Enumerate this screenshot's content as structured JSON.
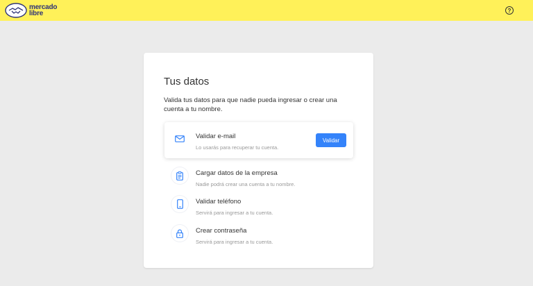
{
  "header": {
    "logo_line1": "mercado",
    "logo_line2": "libre",
    "help_label": "?"
  },
  "card": {
    "title": "Tus datos",
    "subtitle": "Valida tus datos para que nadie pueda ingresar o crear una cuenta a tu nombre.",
    "items": [
      {
        "title": "Validar e-mail",
        "desc": "Lo usarás para recuperar tu cuenta.",
        "icon": "envelope-icon",
        "button": "Validar"
      },
      {
        "title": "Cargar datos de la empresa",
        "desc": "Nadie podrá crear una cuenta a tu nombre.",
        "icon": "clipboard-icon"
      },
      {
        "title": "Validar teléfono",
        "desc": "Servirá para ingresar a tu cuenta.",
        "icon": "phone-icon"
      },
      {
        "title": "Crear contraseña",
        "desc": "Servirá para ingresar a tu cuenta.",
        "icon": "lock-icon"
      }
    ]
  },
  "colors": {
    "header_bg": "#fff159",
    "accent": "#3483fa",
    "page_bg": "#ebebeb"
  }
}
